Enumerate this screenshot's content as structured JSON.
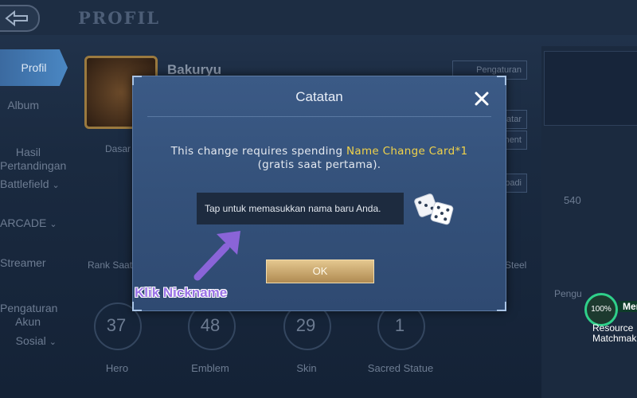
{
  "page": {
    "title": "PROFIL"
  },
  "sidebar": {
    "items": [
      {
        "label": "Profil",
        "active": true
      },
      {
        "label": "Album"
      },
      {
        "label": "Hasil\nPertandingan"
      },
      {
        "label": "Battlefield"
      },
      {
        "label": "ARCADE"
      },
      {
        "label": "Streamer"
      },
      {
        "label": "Pengaturan\nAkun"
      },
      {
        "label": "Sosial"
      }
    ]
  },
  "profile": {
    "username": "Bakuryu",
    "tab_label": "Dasar",
    "rank_label": "Rank Saat",
    "right_label": "Steel",
    "stats": [
      {
        "value": "37",
        "label": "Hero"
      },
      {
        "value": "48",
        "label": "Emblem"
      },
      {
        "value": "29",
        "label": "Skin"
      },
      {
        "value": "1",
        "label": "Sacred Statue"
      }
    ],
    "side_buttons": [
      "Pengaturan",
      "",
      "atar",
      "ment",
      "",
      "badi"
    ],
    "popularity": "540"
  },
  "right_panel": {
    "badge_percent": "100%",
    "badge_text": "Men",
    "resource_line1": "Resource",
    "resource_line2": "Matchmak",
    "pengu_label": "Pengu"
  },
  "modal": {
    "title": "Catatan",
    "message_prefix": "This change requires spending ",
    "message_highlight": "Name Change Card*1",
    "message_suffix": " (gratis saat pertama).",
    "input_placeholder": "Tap untuk memasukkan nama baru Anda.",
    "ok_label": "OK",
    "icons": {
      "close": "close-icon",
      "dice": "dice-icon"
    }
  },
  "annotation": {
    "text": "Klik Nickname"
  },
  "colors": {
    "highlight": "#f0d24a",
    "annotation": "#9a72e6",
    "ok_button": "#c9a56a"
  }
}
